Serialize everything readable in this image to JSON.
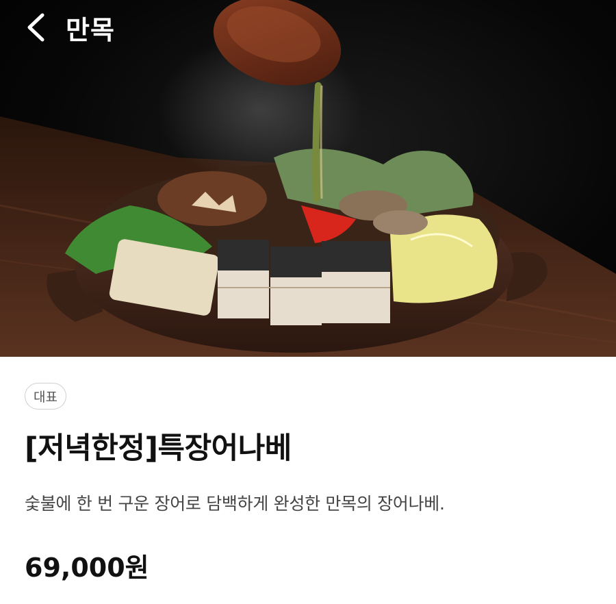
{
  "header": {
    "back_icon": "chevron-left-icon",
    "store_name": "만목"
  },
  "hero": {
    "image": "eel-nabe-hotpot-photo"
  },
  "menu_item": {
    "badge": "대표",
    "title": "[저녁한정]특장어나베",
    "description": "숯불에 한 번 구운 장어로 담백하게 완성한 만목의 장어나베.",
    "price": "69,000원"
  }
}
